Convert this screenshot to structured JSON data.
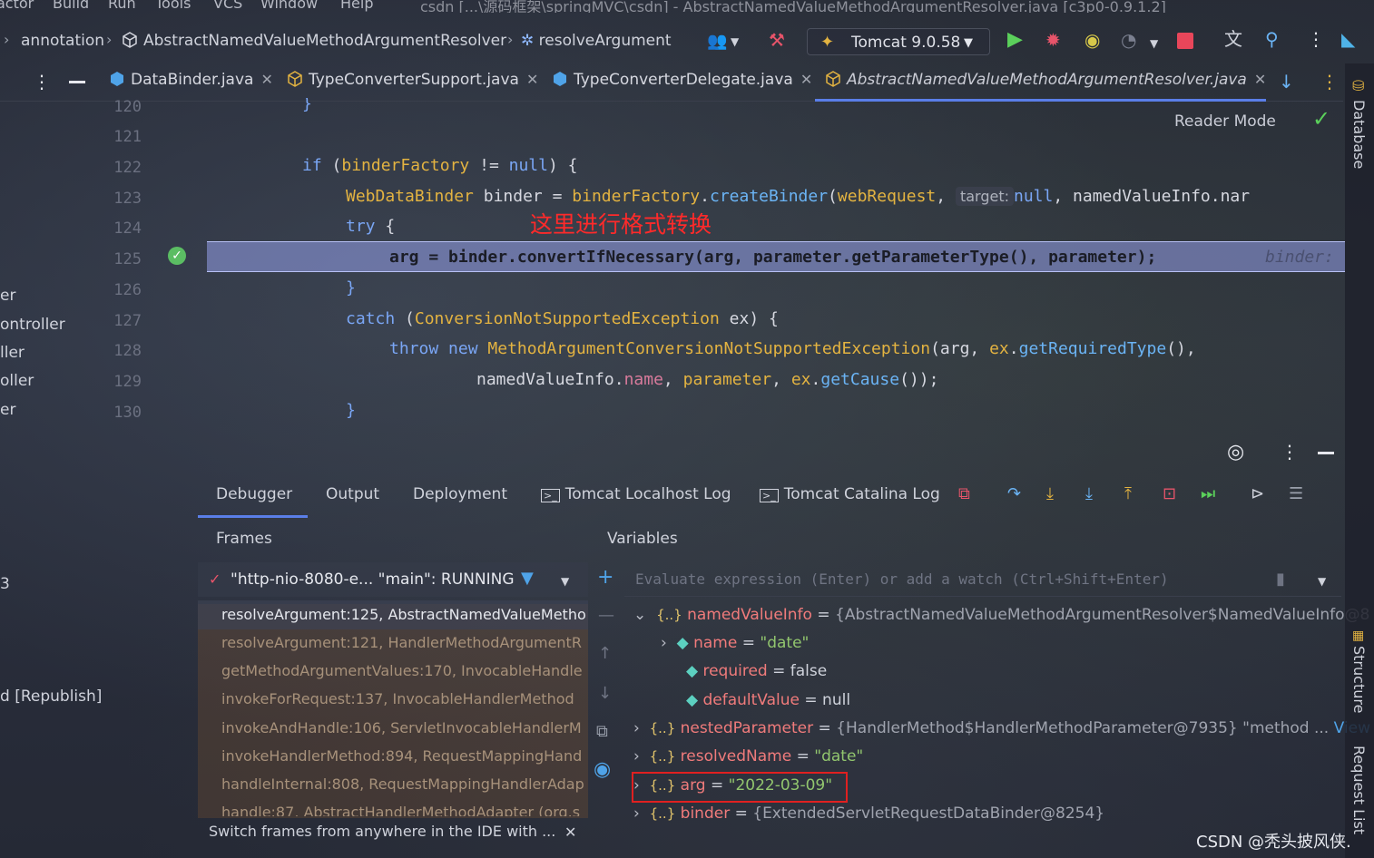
{
  "menu": {
    "items": [
      "actor",
      "Build",
      "Run",
      "Tools",
      "VCS",
      "Window",
      "Help"
    ],
    "title": "csdn [...\\源码框架\\springMVC\\csdn] - AbstractNamedValueMethodArgumentResolver.java [c3p0-0.9.1.2]"
  },
  "nav": {
    "crumb1": "annotation",
    "crumb2": "AbstractNamedValueMethodArgumentResolver",
    "crumb3": "resolveArgument",
    "run_config": "Tomcat 9.0.58"
  },
  "tabs": [
    {
      "label": "DataBinder.java"
    },
    {
      "label": "TypeConverterSupport.java"
    },
    {
      "label": "TypeConverterDelegate.java"
    },
    {
      "label": "AbstractNamedValueMethodArgumentResolver.java"
    }
  ],
  "left_panel": {
    "items": [
      "er",
      "ontroller",
      "ller",
      "oller",
      "er",
      "3",
      "d [Republish]"
    ]
  },
  "editor": {
    "reader_mode": "Reader Mode",
    "annotation": "这里进行格式转换",
    "line_numbers": [
      "120",
      "121",
      "122",
      "123",
      "124",
      "125",
      "126",
      "127",
      "128",
      "129",
      "130"
    ],
    "lines": {
      "l120": "}",
      "l122_kw1": "if",
      "l122_a": " (",
      "l122_b": "binderFactory",
      "l122_c": " != ",
      "l122_kw2": "null",
      "l122_d": ") {",
      "l123_a": "WebDataBinder",
      "l123_b": " binder = ",
      "l123_c": "binderFactory",
      "l123_d": ".",
      "l123_e": "createBinder",
      "l123_f": "(",
      "l123_g": "webRequest",
      "l123_h": ", ",
      "l123_hint": "target:",
      "l123_kw": "null",
      "l123_i": ", namedValueInfo.nar",
      "l124_kw": "try",
      "l124_b": " {",
      "l125": "arg = binder.convertIfNecessary(arg, parameter.getParameterType(), parameter);",
      "l125_hint": "binder:",
      "l126": "}",
      "l127_kw": "catch",
      "l127_a": " (",
      "l127_b": "ConversionNotSupportedException",
      "l127_c": " ex) {",
      "l128_kw1": "throw",
      "l128_kw2": "new",
      "l128_a": "MethodArgumentConversionNotSupportedException",
      "l128_b": "(arg, ",
      "l128_c": "ex",
      "l128_d": ".",
      "l128_e": "getRequiredType",
      "l128_f": "(),",
      "l129_a": "namedValueInfo.",
      "l129_b": "name",
      "l129_c": ", ",
      "l129_d": "parameter",
      "l129_e": ", ",
      "l129_f": "ex",
      "l129_g": ".",
      "l129_h": "getCause",
      "l129_i": "());",
      "l130": "}"
    }
  },
  "debug": {
    "tabs": [
      "Debugger",
      "Output",
      "Deployment",
      "Tomcat Localhost Log",
      "Tomcat Catalina Log"
    ],
    "frames_title": "Frames",
    "variables_title": "Variables",
    "thread": "\"http-nio-8080-e... \"main\": RUNNING",
    "frames": [
      "resolveArgument:125, AbstractNamedValueMetho",
      "resolveArgument:121, HandlerMethodArgumentR",
      "getMethodArgumentValues:170, InvocableHandle",
      "invokeForRequest:137, InvocableHandlerMethod",
      "invokeAndHandle:106, ServletInvocableHandlerM",
      "invokeHandlerMethod:894, RequestMappingHand",
      "handleInternal:808, RequestMappingHandlerAdap",
      "handle:87, AbstractHandlerMethodAdapter (org.s"
    ],
    "tip": "Switch frames from anywhere in the IDE with ...",
    "eval_placeholder": "Evaluate expression (Enter) or add a watch (Ctrl+Shift+Enter)",
    "variables": {
      "v1_name": "namedValueInfo",
      "v1_val": "{AbstractNamedValueMethodArgumentResolver$NamedValueInfo@8",
      "v2_name": "name",
      "v2_val": "\"date\"",
      "v3_name": "required",
      "v3_val": "false",
      "v4_name": "defaultValue",
      "v4_val": "null",
      "v5_name": "nestedParameter",
      "v5_val": "{HandlerMethod$HandlerMethodParameter@7935} \"method ...",
      "v5_link": "View",
      "v6_name": "resolvedName",
      "v6_val": "\"date\"",
      "v7_name": "arg",
      "v7_val": "\"2022-03-09\"",
      "v8_name": "binder",
      "v8_val": "{ExtendedServletRequestDataBinder@8254}"
    }
  },
  "right_sidebar": [
    "Database",
    "Structure",
    "Request List"
  ],
  "watermark": "CSDN @秃头披风侠.",
  "colors": {
    "accent": "#5a7ee8",
    "exec_line": "#96a0eb",
    "highlight_box": "#e02020",
    "annotation": "#ff2a2a"
  }
}
